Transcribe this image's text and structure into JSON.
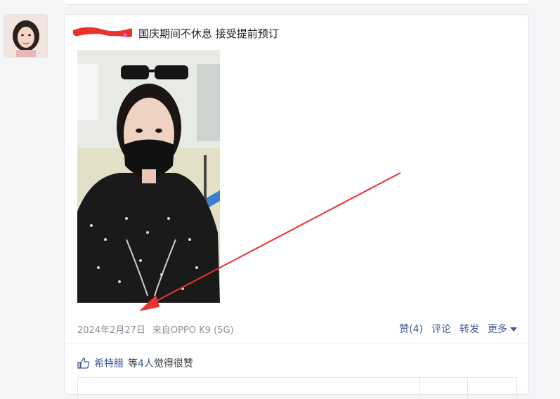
{
  "post": {
    "text": "国庆期间不休息 接受提前预订",
    "date": "2024年2月27日",
    "source": "来自OPPO K9 (5G)"
  },
  "actions": {
    "like": "赞(4)",
    "comment": "评论",
    "repost": "转发",
    "more": "更多"
  },
  "likes": {
    "liker": "希特腊",
    "prefix": "等",
    "count": "4人",
    "suffix": "觉得很赞"
  },
  "colors": {
    "link": "#3b5998",
    "annotation_arrow": "#e8322e",
    "redaction": "#e8322e"
  }
}
